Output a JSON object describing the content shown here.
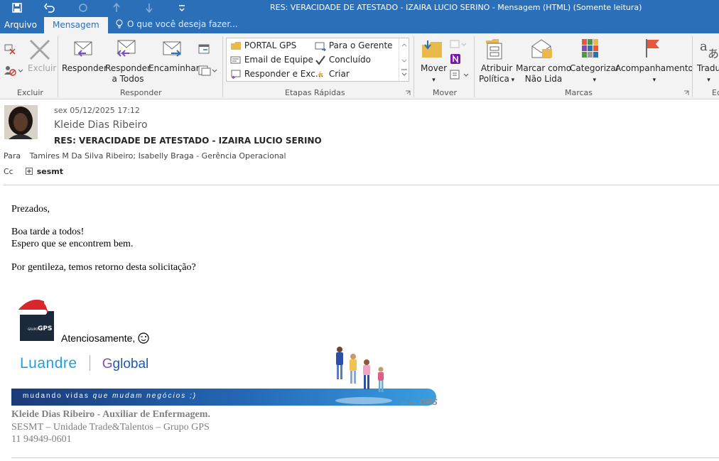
{
  "window": {
    "title": "RES: VERACIDADE DE ATESTADO -  IZAIRA  LUCIO SERINO - Mensagem (HTML) (Somente leitura)"
  },
  "tabs": {
    "arquivo": "Arquivo",
    "mensagem": "Mensagem",
    "tell_me": "O que você deseja fazer..."
  },
  "ribbon": {
    "excluir_group": {
      "label": "Excluir",
      "delete_label": "Excluir"
    },
    "responder_group": {
      "label": "Responder",
      "reply": "Responder",
      "reply_all_line1": "Responder",
      "reply_all_line2": "a Todos",
      "forward": "Encaminhar"
    },
    "quick_steps": {
      "label": "Etapas Rápidas",
      "items": [
        "PORTAL GPS",
        "Para o Gerente",
        "Email de Equipe",
        "Concluído",
        "Responder e Exc...",
        "Criar"
      ]
    },
    "mover_group": {
      "label": "Mover",
      "move": "Mover"
    },
    "marcas_group": {
      "label": "Marcas",
      "assign_policy_line1": "Atribuir",
      "assign_policy_line2": "Política",
      "mark_unread_line1": "Marcar como",
      "mark_unread_line2": "Não Lida",
      "categorize": "Categorizar",
      "follow_up": "Acompanhamento"
    },
    "edicao_group": {
      "label": "Ed",
      "translate": "Tradu"
    }
  },
  "message": {
    "date": "sex 05/12/2025 17:12",
    "sender": "Kleide Dias Ribeiro",
    "subject": "RES: VERACIDADE DE ATESTADO -  IZAIRA  LUCIO SERINO",
    "to_label": "Para",
    "to": "Tamires M Da Silva Ribeiro; Isabelly Braga - Gerência Operacional",
    "cc_label": "Cc",
    "cc": "sesmt"
  },
  "body": {
    "greeting": "Prezados,",
    "line1": "Boa tarde a todos!",
    "line2": "Espero que se encontrem bem.",
    "line3": "Por gentileza, temos retorno desta solicitação?"
  },
  "signature": {
    "logo_text": "GPS",
    "logo_small": "GRUPO",
    "closing": "Atenciosamente,",
    "brand1": "Luandre",
    "brand2": "global",
    "tagline_bold": "mudando vidas",
    "tagline_rest": "que mudam negócios ;)",
    "banner_brand_small": "GRUPO",
    "banner_brand": "GPS",
    "name_line": "Kleide Dias Ribeiro - Auxiliar de Enfermagem.",
    "dept_line": "SESMT – Unidade Trade&Talentos – Grupo GPS",
    "phone": "11 94949-0601"
  }
}
